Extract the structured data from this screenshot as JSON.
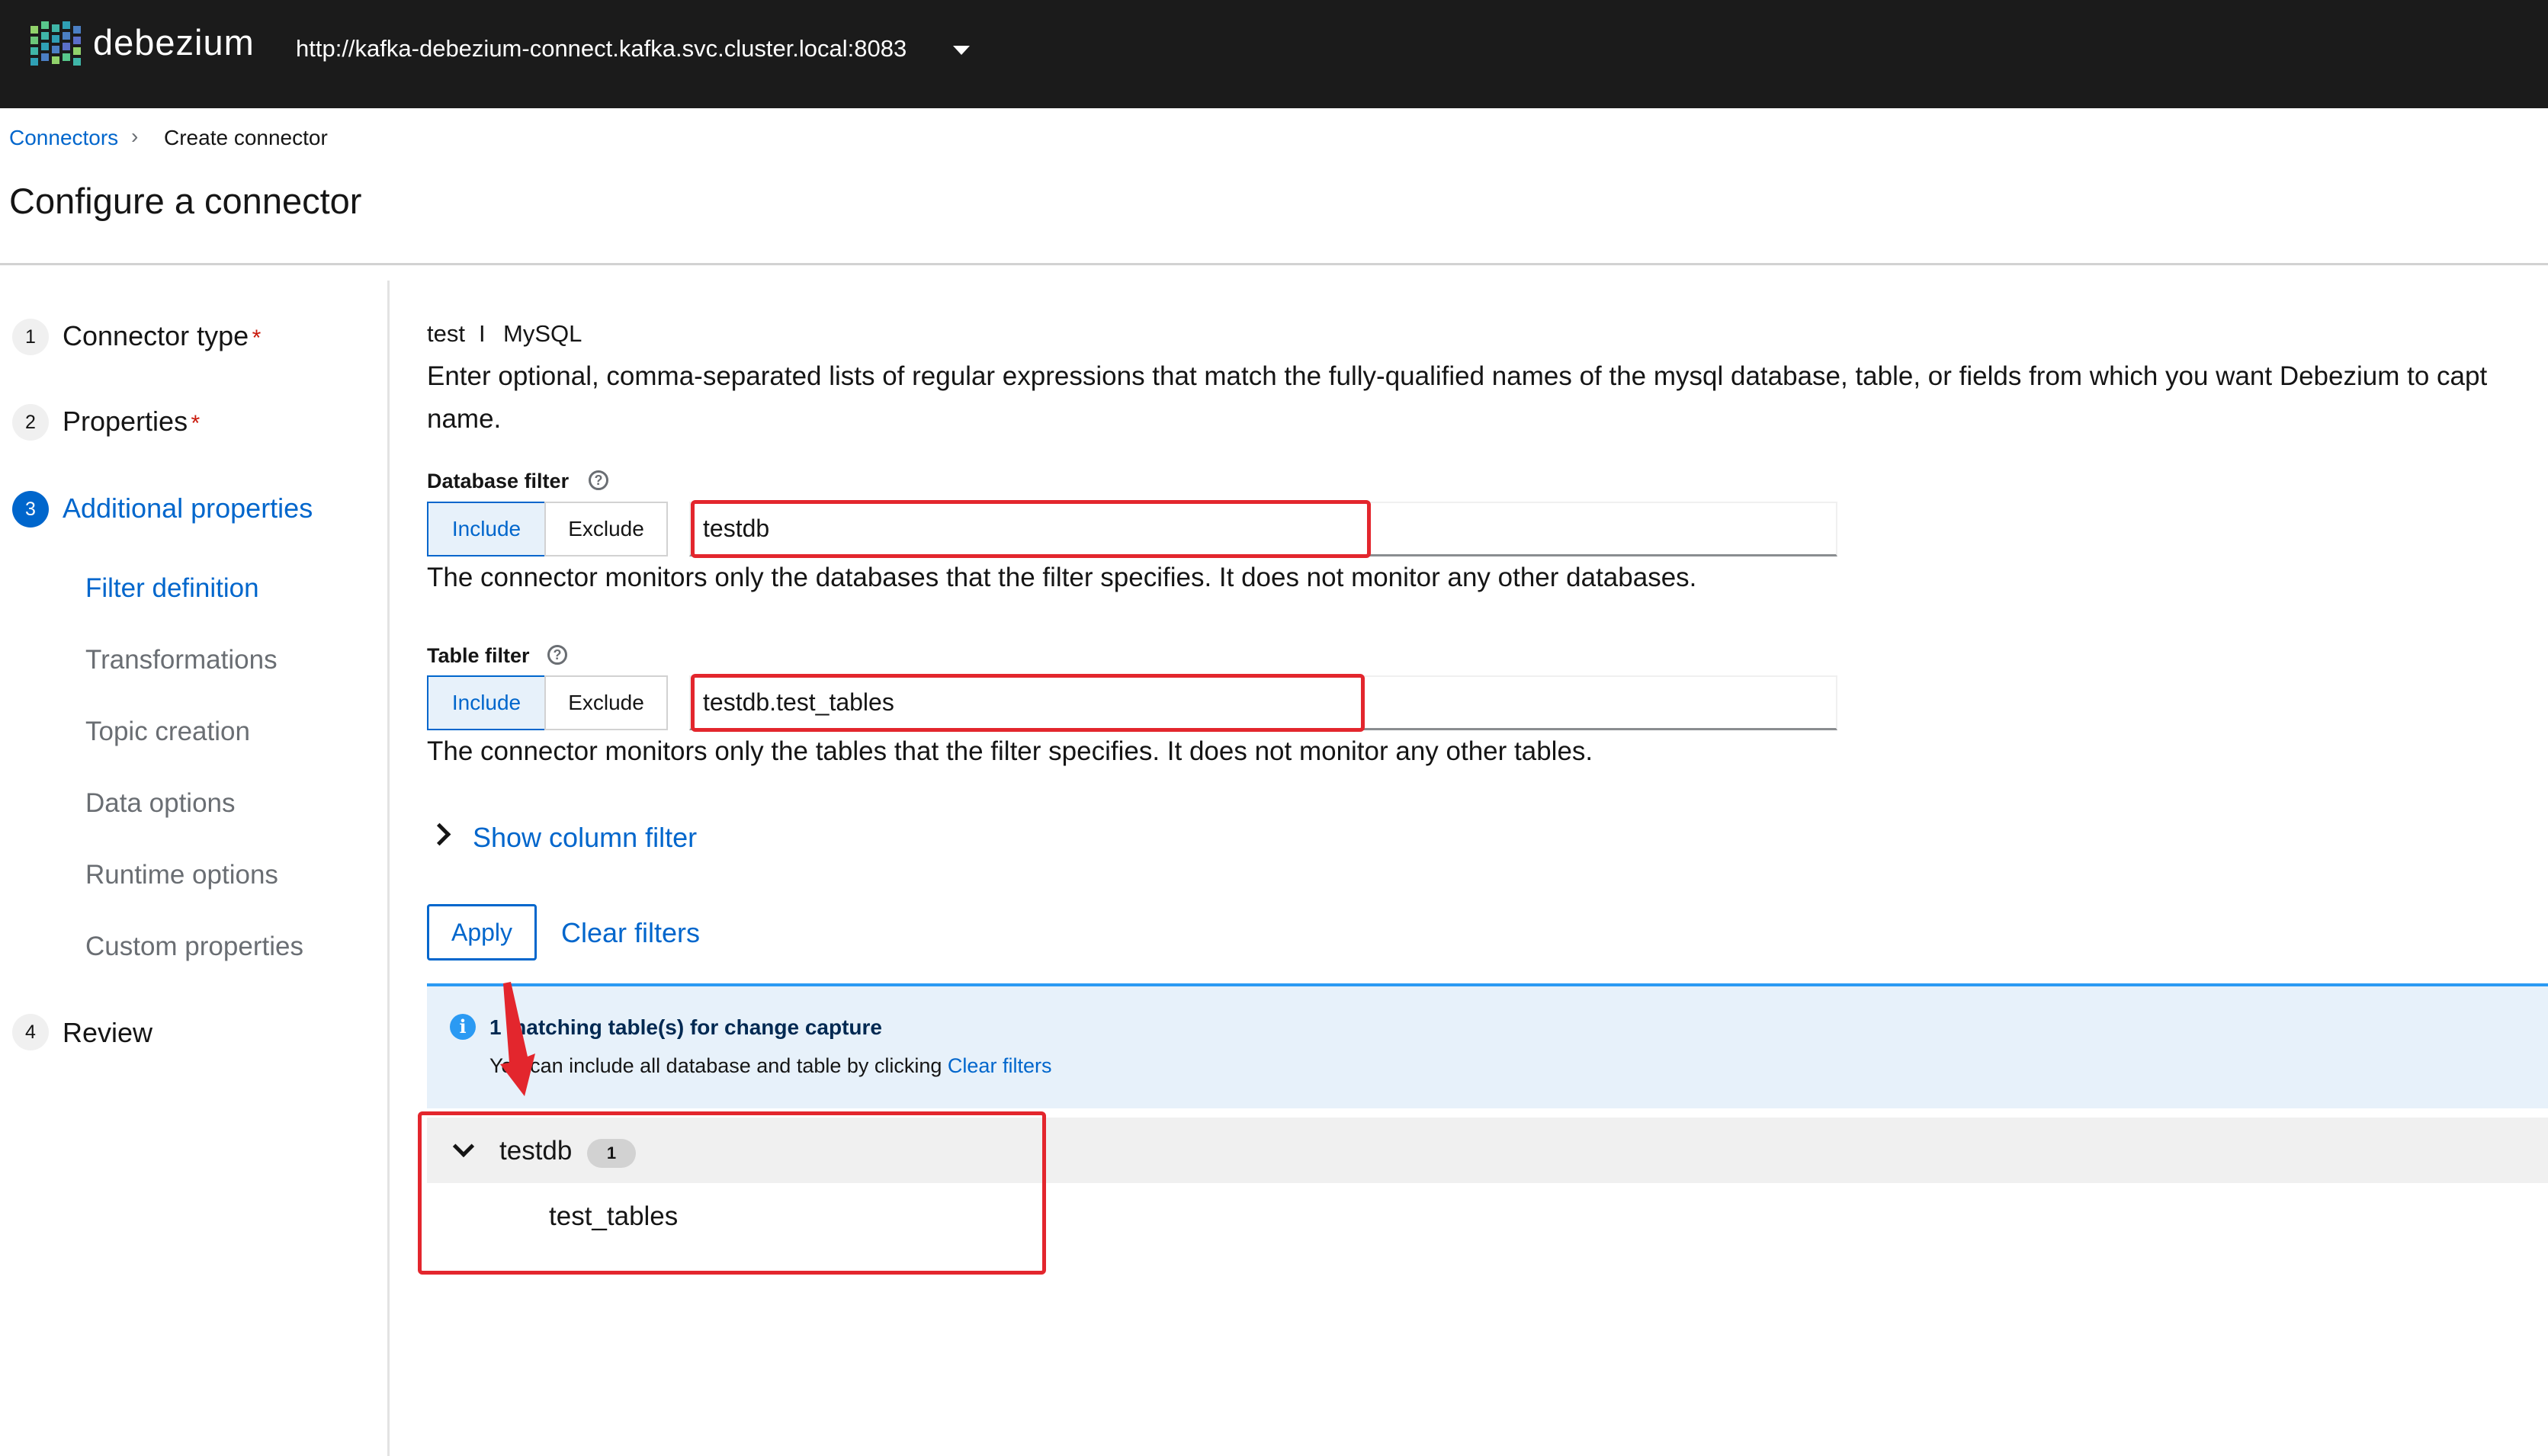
{
  "header": {
    "brand": "debezium",
    "cluster_url": "http://kafka-debezium-connect.kafka.svc.cluster.local:8083"
  },
  "breadcrumb": {
    "parent": "Connectors",
    "separator": "›",
    "current": "Create connector"
  },
  "page_title": "Configure a connector",
  "steps": [
    {
      "num": "1",
      "label": "Connector type",
      "required": "*"
    },
    {
      "num": "2",
      "label": "Properties",
      "required": "*"
    },
    {
      "num": "3",
      "label": "Additional properties",
      "required": ""
    },
    {
      "num": "4",
      "label": "Review",
      "required": ""
    }
  ],
  "substeps": [
    "Filter definition",
    "Transformations",
    "Topic creation",
    "Data options",
    "Runtime options",
    "Custom properties"
  ],
  "main": {
    "connector_name": "test",
    "separator": "I",
    "connector_type": "MySQL",
    "description_line1": "Enter optional, comma-separated lists of regular expressions that match the fully-qualified names of the mysql database, table, or fields from which you want Debezium to capt",
    "description_line2": "name.",
    "database_filter": {
      "label": "Database filter",
      "include": "Include",
      "exclude": "Exclude",
      "value": "testdb",
      "helper": "The connector monitors only the databases that the filter specifies. It does not monitor any other databases."
    },
    "table_filter": {
      "label": "Table filter",
      "include": "Include",
      "exclude": "Exclude",
      "value": "testdb.test_tables",
      "helper": "The connector monitors only the tables that the filter specifies. It does not monitor any other tables."
    },
    "show_column_filter": "Show column filter",
    "apply": "Apply",
    "clear_filters": "Clear filters",
    "alert": {
      "title": "1 matching table(s) for change capture",
      "body_prefix": "You can include all database and table by clicking ",
      "body_link": "Clear filters"
    },
    "tree": {
      "database": "testdb",
      "count": "1",
      "tables": [
        "test_tables"
      ]
    }
  },
  "colors": {
    "header_bg": "#1b1b1b",
    "accent": "#0066cc",
    "highlight_red": "#e3262d",
    "alert_bg": "#e7f1fa"
  },
  "icons": {
    "logo": "debezium-logo-icon",
    "caret": "caret-down-icon",
    "help": "help-circle-icon",
    "info": "info-circle-icon",
    "chevron_right": "chevron-right-icon",
    "chevron_down": "chevron-down-icon"
  }
}
